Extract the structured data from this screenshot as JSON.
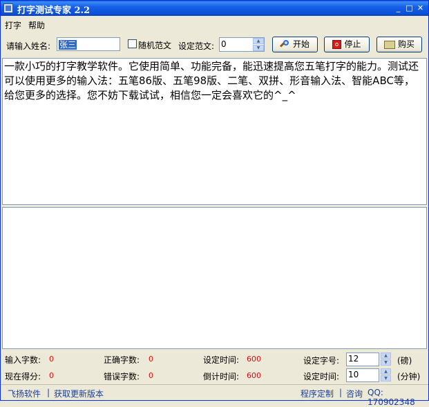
{
  "window": {
    "title": "打字测试专家 2.2",
    "controls": {
      "minimize": "_",
      "maximize": "□",
      "close": "✕"
    }
  },
  "menu": {
    "items": [
      "打字",
      "帮助"
    ]
  },
  "toolbar": {
    "name_label": "请输入姓名:",
    "name_value": "张三",
    "random_label": "随机范文",
    "article_label": "设定范文:",
    "article_value": "0",
    "start_label": "开始",
    "stop_label": "停止",
    "buy_label": "购买"
  },
  "article_text": "一款小巧的打字教学软件。它使用简单、功能完备，能迅速提高您五笔打字的能力。测试还可以使用更多的输入法：五笔86版、五笔98版、二笔、双拼、形音输入法、智能ABC等，给您更多的选择。您不妨下载试试，相信您一定会喜欢它的^_^",
  "stats": {
    "input_chars_label": "输入字数:",
    "input_chars": "0",
    "correct_chars_label": "正确字数:",
    "correct_chars": "0",
    "set_time_label": "设定时间:",
    "set_time": "600",
    "score_label": "现在得分:",
    "score": "0",
    "error_chars_label": "错误字数:",
    "error_chars": "0",
    "countdown_label": "倒计时间:",
    "countdown": "600",
    "font_size_label": "设定字号:",
    "font_size": "12",
    "font_size_unit": "(磅)",
    "time_label": "设定时间:",
    "time_value": "10",
    "time_unit": "(分钟)"
  },
  "statusbar": {
    "left_link": "飞扬软件",
    "update_link": "获取更新版本",
    "custom_link": "程序定制",
    "consult_link": "咨询",
    "qq": "QQ: 170902348",
    "separator": "|"
  }
}
